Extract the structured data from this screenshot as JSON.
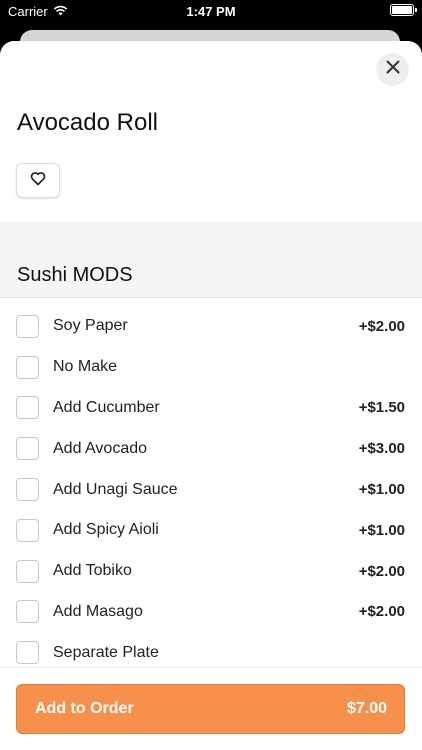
{
  "status_bar": {
    "carrier": "Carrier",
    "time": "1:47 PM"
  },
  "item": {
    "title": "Avocado Roll"
  },
  "section": {
    "title": "Sushi MODS"
  },
  "options": [
    {
      "label": "Soy Paper",
      "price": "+$2.00"
    },
    {
      "label": "No Make",
      "price": ""
    },
    {
      "label": "Add Cucumber",
      "price": "+$1.50"
    },
    {
      "label": "Add Avocado",
      "price": "+$3.00"
    },
    {
      "label": "Add Unagi Sauce",
      "price": "+$1.00"
    },
    {
      "label": "Add Spicy Aioli",
      "price": "+$1.00"
    },
    {
      "label": "Add Tobiko",
      "price": "+$2.00"
    },
    {
      "label": "Add Masago",
      "price": "+$2.00"
    },
    {
      "label": "Separate Plate",
      "price": ""
    }
  ],
  "footer": {
    "add_label": "Add to Order",
    "total": "$7.00"
  },
  "colors": {
    "accent": "#f7904a",
    "section_bg": "#f5f5f5"
  },
  "icons": {
    "close": "close-icon",
    "favorite": "heart-icon",
    "wifi": "wifi-icon",
    "battery": "battery-icon"
  }
}
